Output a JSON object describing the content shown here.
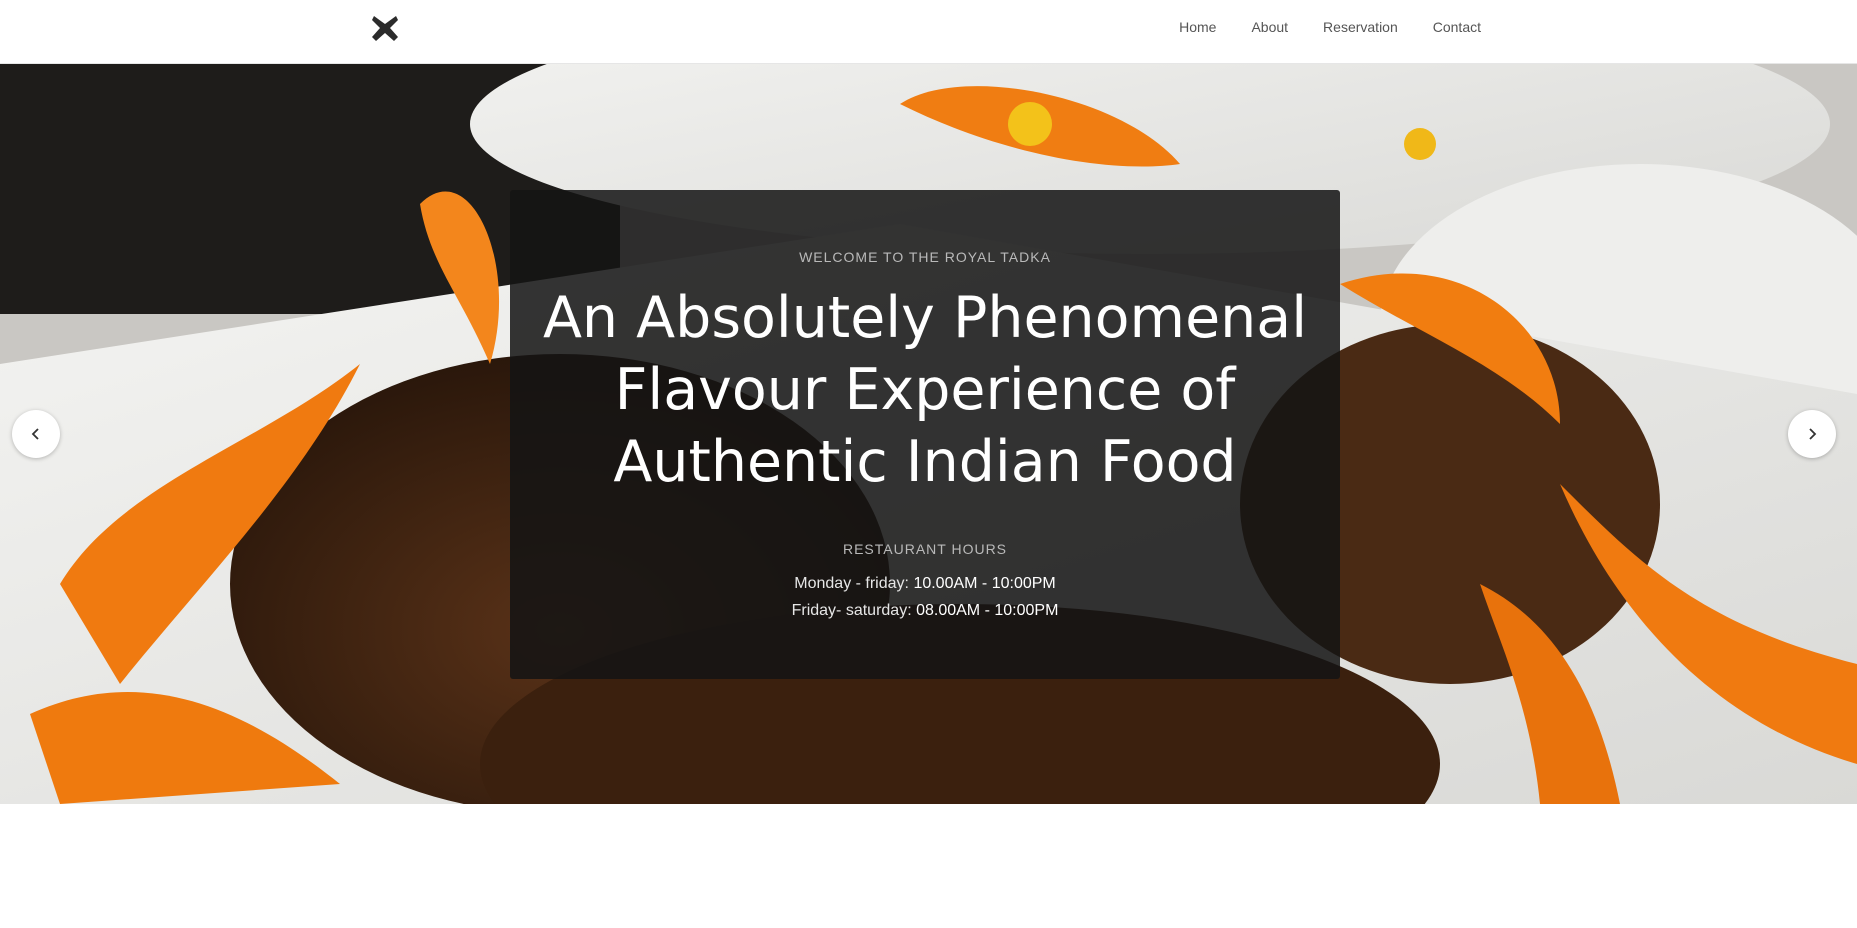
{
  "header": {
    "logo_icon": "x-logo-icon",
    "nav": [
      {
        "label": "Home"
      },
      {
        "label": "About"
      },
      {
        "label": "Reservation"
      },
      {
        "label": "Contact"
      }
    ]
  },
  "hero": {
    "eyebrow": "WELCOME TO THE ROYAL TADKA",
    "headline": "An Absolutely Phenomenal Flavour Experience of Authentic Indian Food",
    "hours_title": "RESTAURANT HOURS",
    "hours": [
      {
        "days": "Monday - friday:",
        "time": "10.00AM - 10:00PM"
      },
      {
        "days": "Friday- saturday:",
        "time": "08.00AM - 10:00PM"
      }
    ],
    "prev_icon": "chevron-left-icon",
    "next_icon": "chevron-right-icon"
  }
}
